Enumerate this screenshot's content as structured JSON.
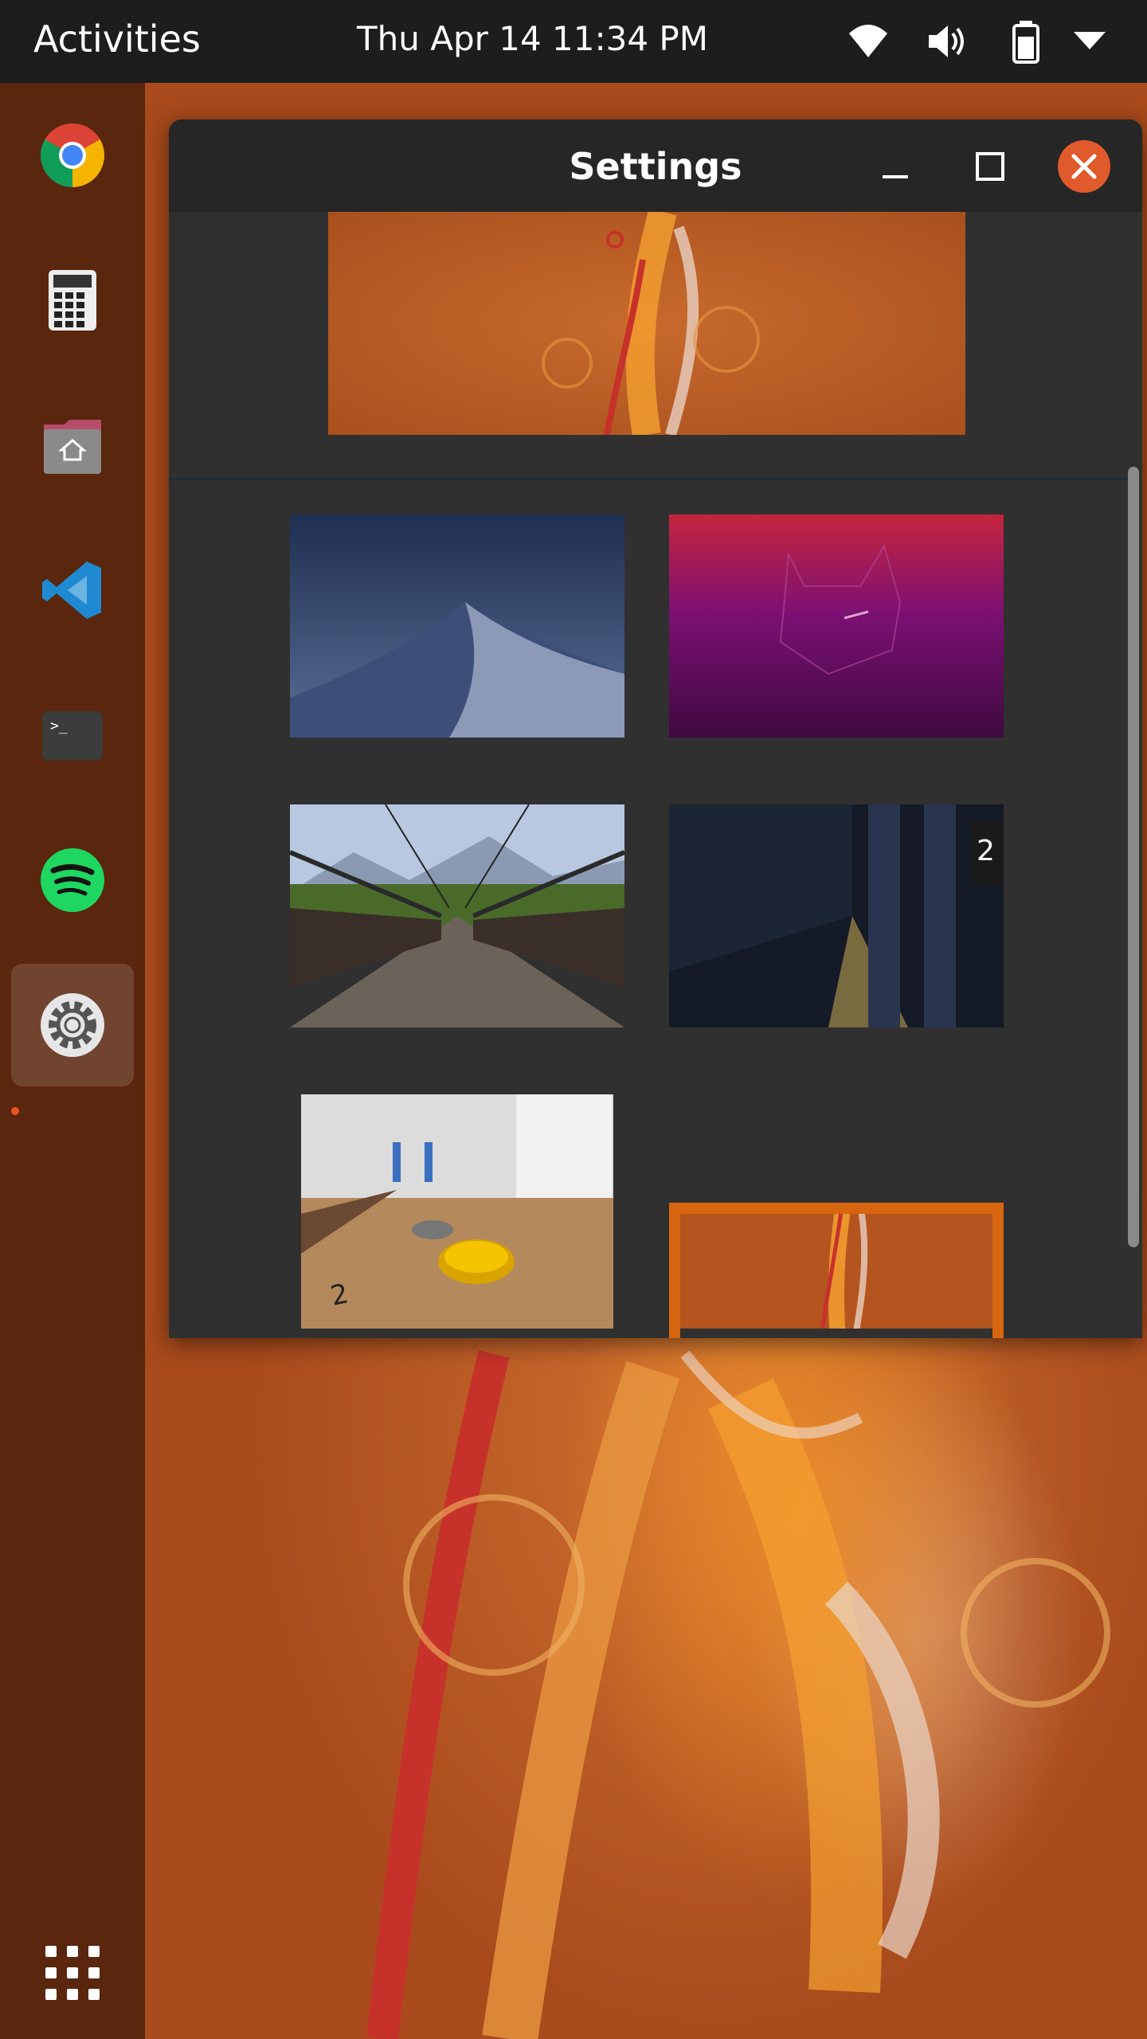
{
  "topbar": {
    "activities_label": "Activities",
    "clock": "Thu Apr 14 11:34 PM",
    "tray_icons": [
      "wifi-icon",
      "volume-icon",
      "battery-icon",
      "system-menu-chevron-icon"
    ]
  },
  "dock": {
    "apps": [
      "chrome-icon",
      "calculator-icon",
      "files-home-icon",
      "vscode-icon",
      "terminal-icon",
      "spotify-icon",
      "settings-gear-icon",
      "show-apps-grid-icon"
    ],
    "active_app": "settings-gear-icon"
  },
  "window": {
    "title": "Settings",
    "controls": [
      "minimize-icon",
      "maximize-icon",
      "close-icon"
    ]
  },
  "wallpapers": {
    "items": [
      "desert-dunes",
      "ubuntu-purple-cat",
      "suspension-bridge",
      "subway-station",
      "shuffleboard",
      "ubuntu-orange-bird"
    ],
    "selected": "ubuntu-orange-bird"
  },
  "colors": {
    "accent": "#e95420",
    "selection_border": "#d8650f",
    "topbar_bg": "#1d1d1d",
    "window_bg": "#303030"
  }
}
